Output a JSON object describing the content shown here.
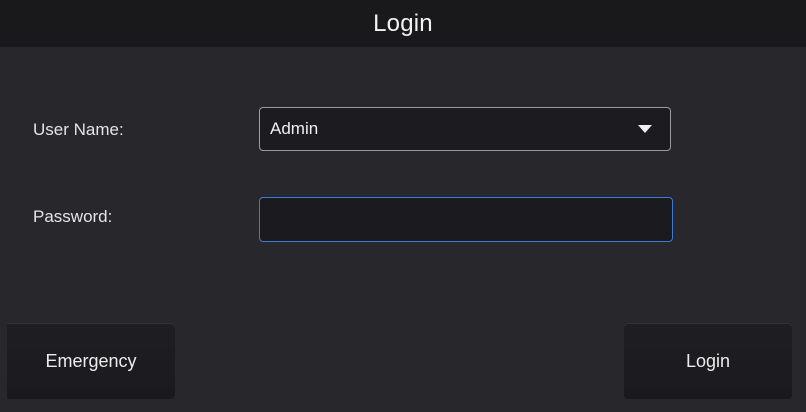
{
  "window": {
    "title": "Login"
  },
  "form": {
    "username_label": "User Name:",
    "username_value": "Admin",
    "password_label": "Password:",
    "password_value": ""
  },
  "buttons": {
    "emergency_label": "Emergency",
    "login_label": "Login"
  },
  "colors": {
    "focus_border": "#3a7bd5",
    "background": "#27272c",
    "titlebar": "#19191c"
  }
}
